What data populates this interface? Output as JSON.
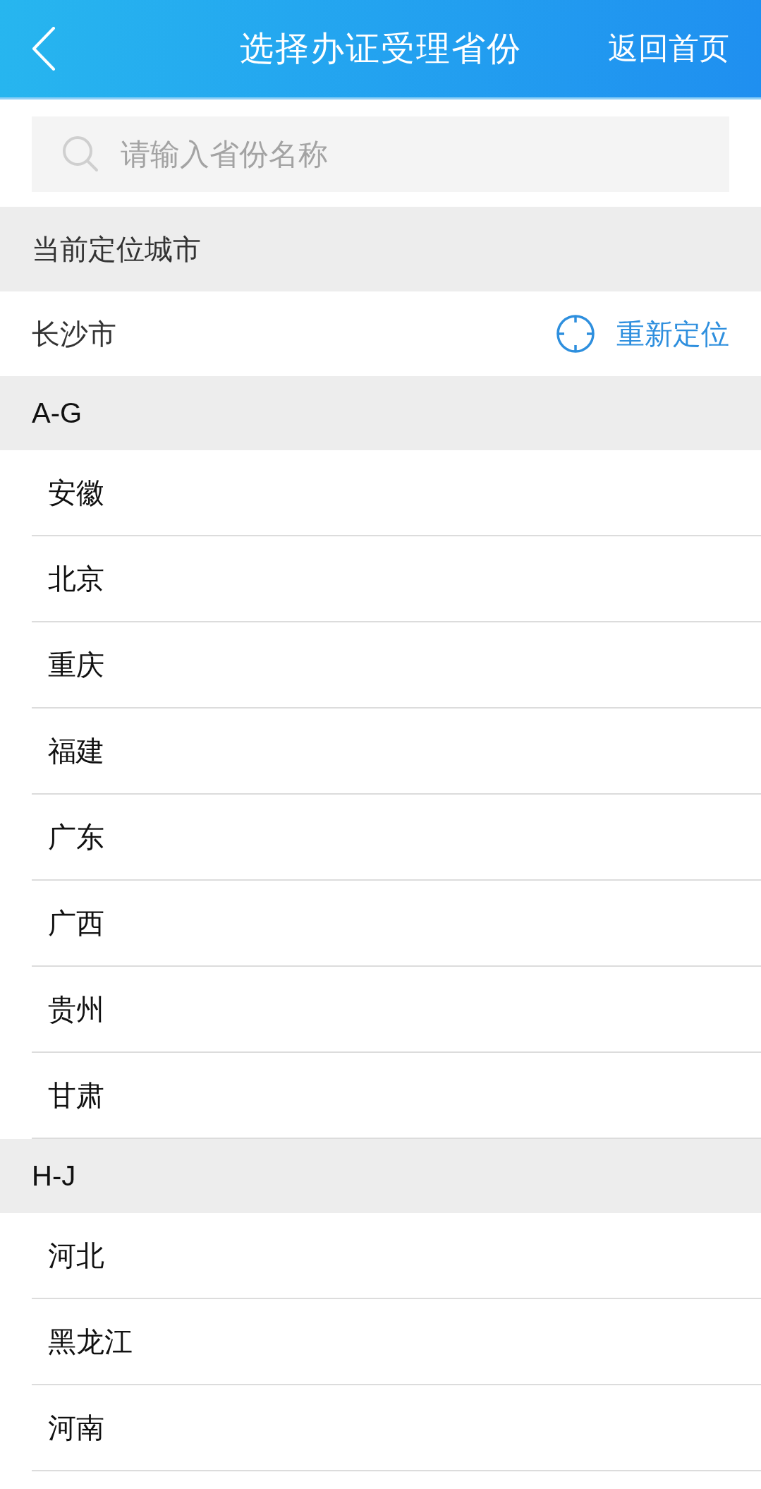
{
  "header": {
    "title": "选择办证受理省份",
    "action": "返回首页"
  },
  "search": {
    "placeholder": "请输入省份名称"
  },
  "location": {
    "heading": "当前定位城市",
    "city": "长沙市",
    "relocate": "重新定位"
  },
  "groups": [
    {
      "label": "A-G",
      "provinces": [
        "安徽",
        "北京",
        "重庆",
        "福建",
        "广东",
        "广西",
        "贵州",
        "甘肃"
      ]
    },
    {
      "label": "H-J",
      "provinces": [
        "河北",
        "黑龙江",
        "河南"
      ]
    }
  ]
}
